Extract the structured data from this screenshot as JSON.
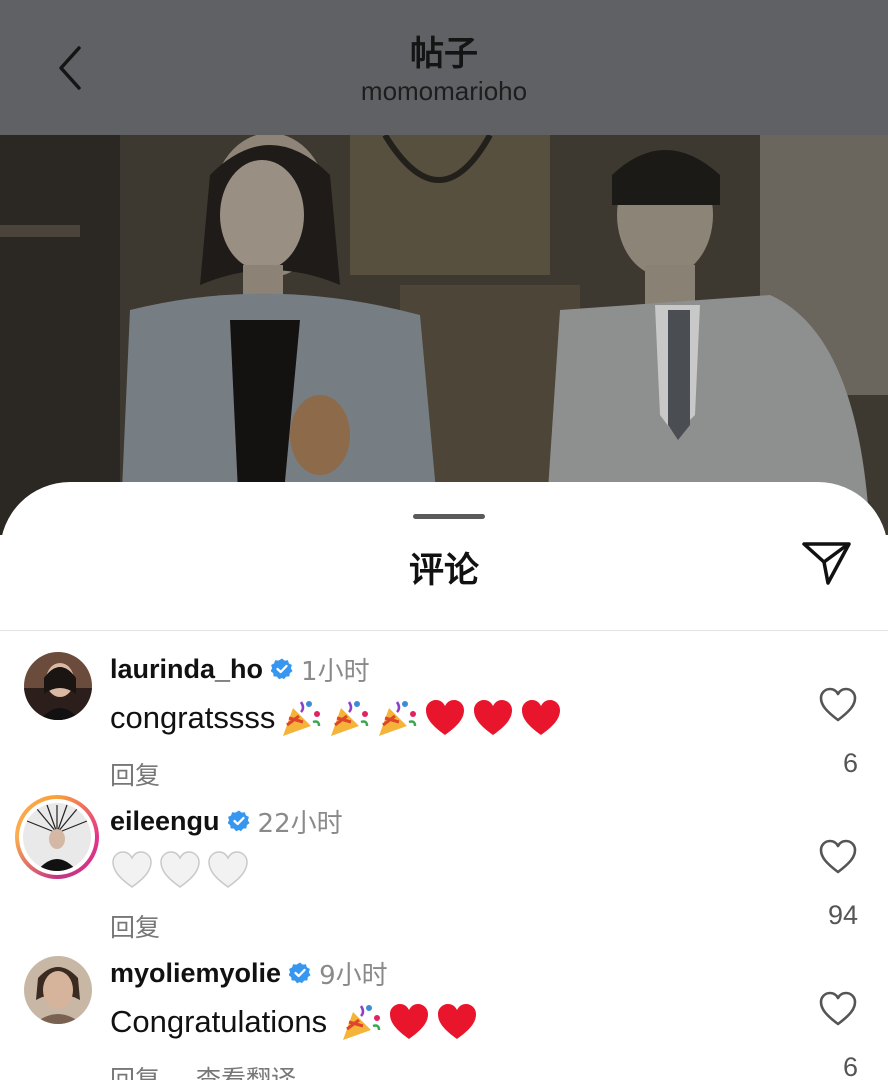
{
  "header": {
    "title": "帖子",
    "subtitle": "momomarioho"
  },
  "sheet": {
    "title": "评论"
  },
  "comments": [
    {
      "username": "laurinda_ho",
      "verified": true,
      "time": "1小时",
      "text": "congratssss",
      "emojis": [
        "party-popper",
        "party-popper",
        "party-popper",
        "red-heart",
        "red-heart",
        "red-heart"
      ],
      "reply_label": "回复",
      "likes": "6"
    },
    {
      "username": "eileengu",
      "verified": true,
      "time": "22小时",
      "text": "",
      "emojis": [
        "white-heart",
        "white-heart",
        "white-heart"
      ],
      "reply_label": "回复",
      "likes": "94"
    },
    {
      "username": "myoliemyolie",
      "verified": true,
      "time": "9小时",
      "text": "Congratulations",
      "emojis": [
        "party-popper",
        "red-heart",
        "red-heart"
      ],
      "reply_label": "回复",
      "translate_label": "查看翻译",
      "likes": "6"
    }
  ],
  "colors": {
    "verified_blue": "#3797f0",
    "heart_red": "#e0245e",
    "meta_gray": "#8a8a8a"
  }
}
